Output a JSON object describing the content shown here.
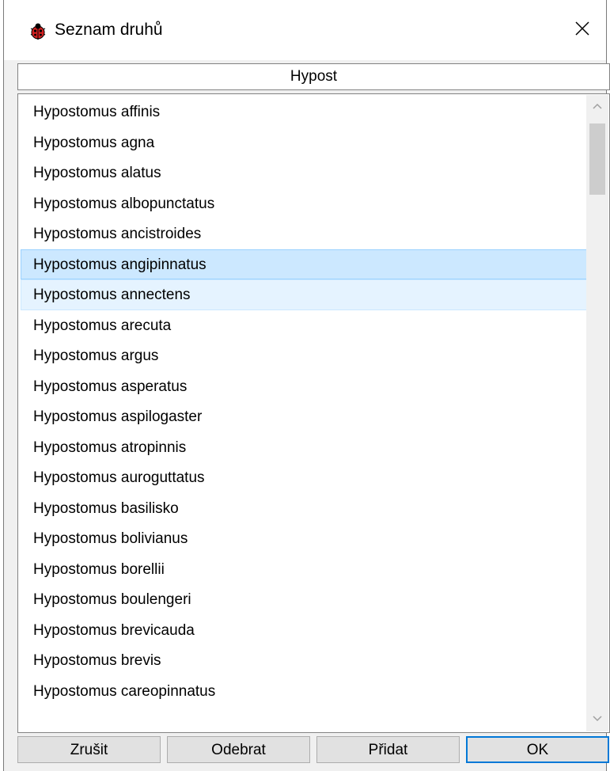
{
  "window": {
    "title": "Seznam druhů",
    "icon": "ladybug-icon"
  },
  "filter": {
    "value": "Hypost"
  },
  "list": {
    "items": [
      "Hypostomus affinis",
      "Hypostomus agna",
      "Hypostomus alatus",
      "Hypostomus albopunctatus",
      "Hypostomus ancistroides",
      "Hypostomus angipinnatus",
      "Hypostomus annectens",
      "Hypostomus arecuta",
      "Hypostomus argus",
      "Hypostomus asperatus",
      "Hypostomus aspilogaster",
      "Hypostomus atropinnis",
      "Hypostomus auroguttatus",
      "Hypostomus basilisko",
      "Hypostomus bolivianus",
      "Hypostomus borellii",
      "Hypostomus boulengeri",
      "Hypostomus brevicauda",
      "Hypostomus brevis",
      "Hypostomus careopinnatus"
    ],
    "selected_index": 5,
    "hover_index": 6
  },
  "buttons": {
    "cancel": "Zrušit",
    "remove": "Odebrat",
    "add": "Přidat",
    "ok": "OK"
  },
  "colors": {
    "selected_bg": "#cce8ff",
    "hover_bg": "#e5f3ff",
    "default_button_border": "#0078d7"
  }
}
